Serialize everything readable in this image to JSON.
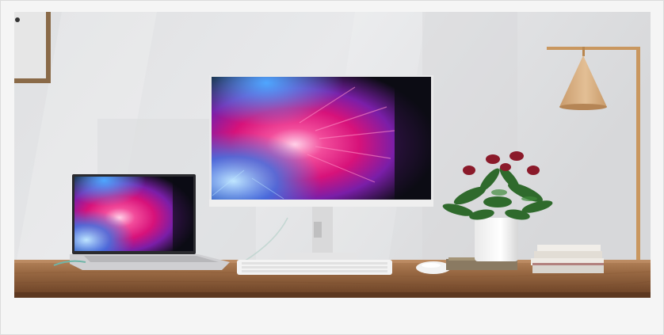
{
  "photo": {
    "alt": "",
    "colors": {
      "wall": "#e3e4e6",
      "desk": "#9a6a44",
      "monitor_frame": "#e9e9ea",
      "lamp_shade": "#d9b48a",
      "plant_leaf": "#2f6a2c",
      "flower": "#8b1a2a",
      "screen_pink": "#e2207a",
      "screen_blue": "#3b7be8",
      "screen_dark": "#0c0c14"
    },
    "objects": [
      "wall-frame",
      "laptop",
      "monitor",
      "keyboard",
      "mouse",
      "potted-plant",
      "book-stack",
      "floor-lamp"
    ]
  }
}
